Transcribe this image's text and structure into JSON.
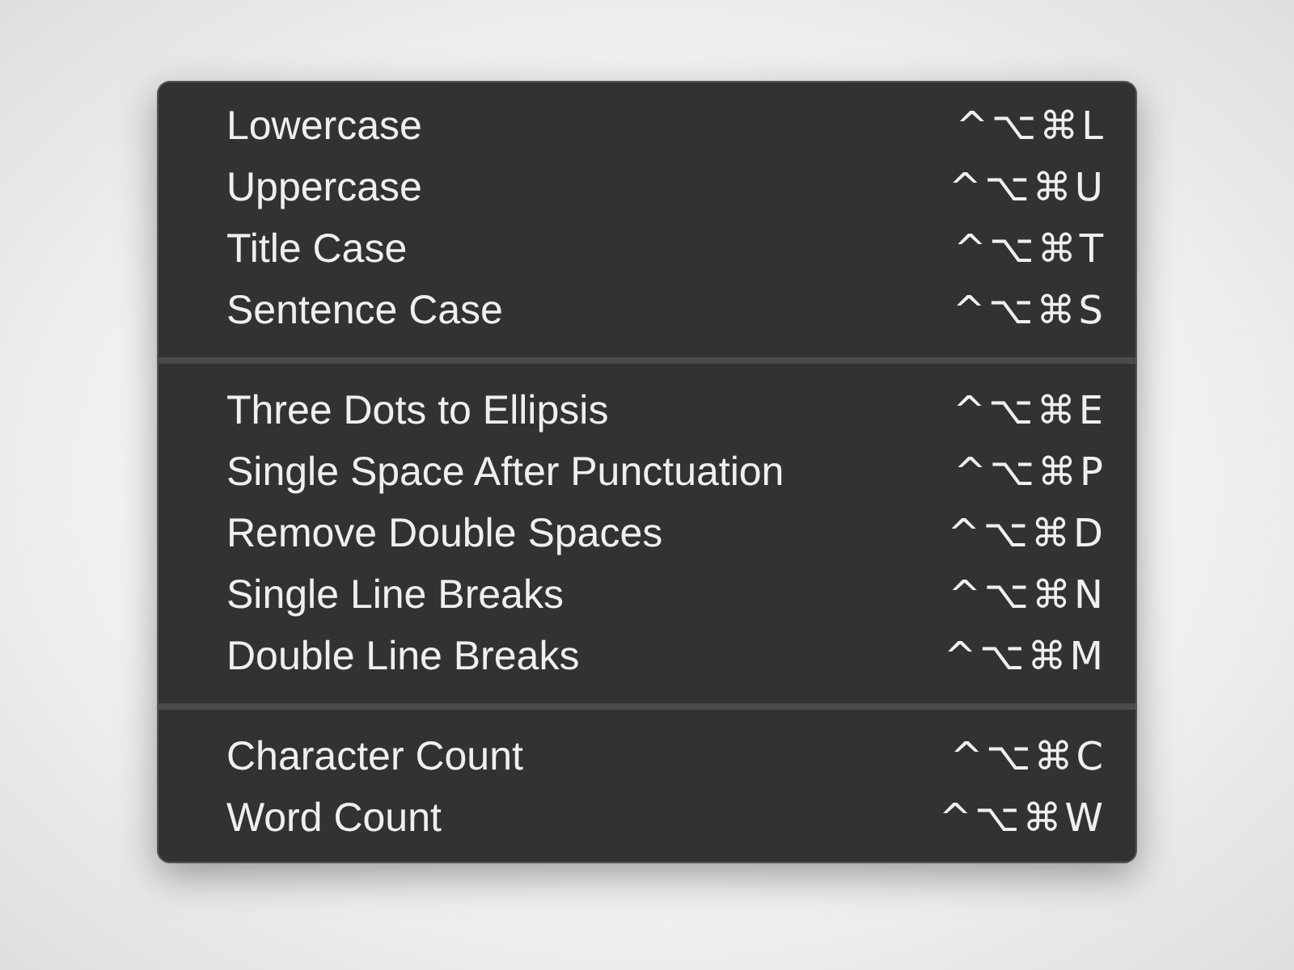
{
  "menu": {
    "sections": [
      [
        {
          "label": "Lowercase",
          "shortcut": "^⌥⌘L"
        },
        {
          "label": "Uppercase",
          "shortcut": "^⌥⌘U"
        },
        {
          "label": "Title Case",
          "shortcut": "^⌥⌘T"
        },
        {
          "label": "Sentence Case",
          "shortcut": "^⌥⌘S"
        }
      ],
      [
        {
          "label": "Three Dots to Ellipsis",
          "shortcut": "^⌥⌘E"
        },
        {
          "label": "Single Space After Punctuation",
          "shortcut": "^⌥⌘P"
        },
        {
          "label": "Remove Double Spaces",
          "shortcut": "^⌥⌘D"
        },
        {
          "label": "Single Line Breaks",
          "shortcut": "^⌥⌘N"
        },
        {
          "label": "Double Line Breaks",
          "shortcut": "^⌥⌘M"
        }
      ],
      [
        {
          "label": "Character Count",
          "shortcut": "^⌥⌘C"
        },
        {
          "label": "Word Count",
          "shortcut": "^⌥⌘W"
        }
      ]
    ]
  }
}
